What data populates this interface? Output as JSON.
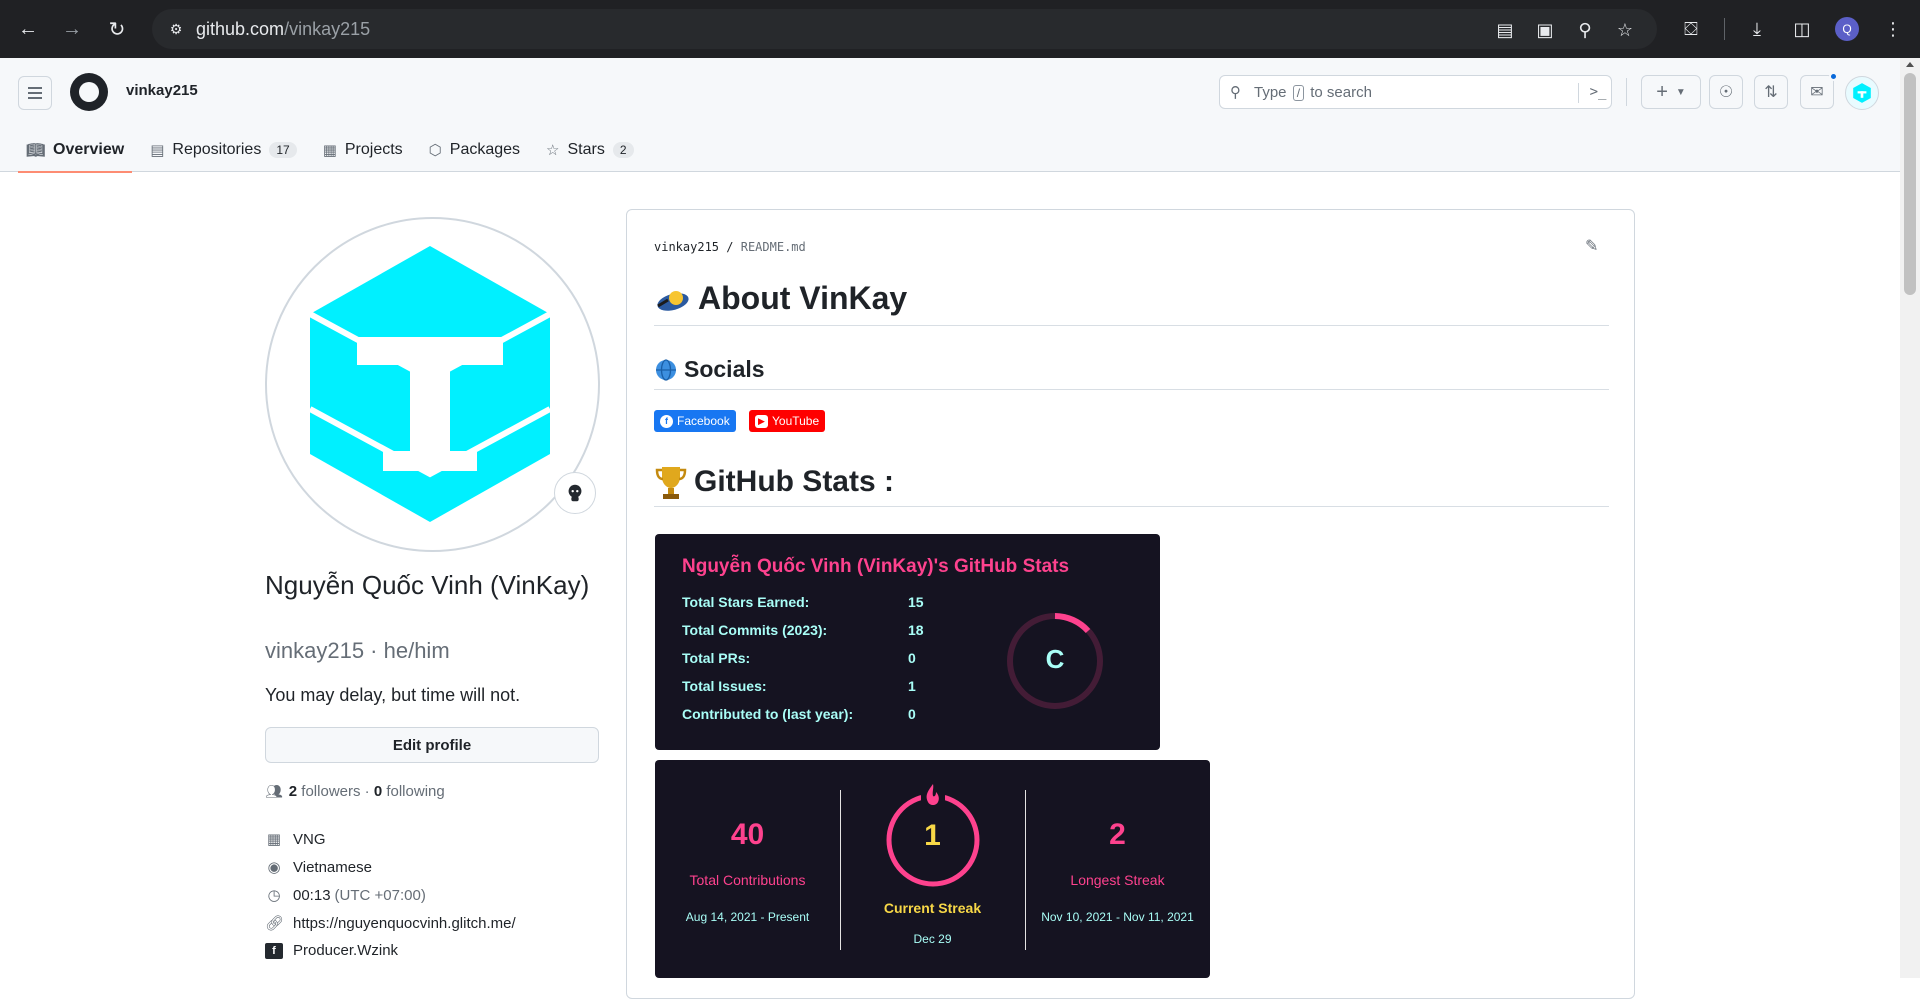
{
  "browser": {
    "url_host": "github.com",
    "url_path": "/vinkay215",
    "profile_initial": "Q"
  },
  "header": {
    "username": "vinkay215",
    "search": {
      "prefix": "Type",
      "key": "/",
      "suffix": "to search"
    },
    "command_glyph": ">_",
    "plus_label": "+"
  },
  "tabs": [
    {
      "label": "Overview",
      "icon": "book-icon",
      "count": null
    },
    {
      "label": "Repositories",
      "icon": "repo-icon",
      "count": "17"
    },
    {
      "label": "Projects",
      "icon": "table-icon",
      "count": null
    },
    {
      "label": "Packages",
      "icon": "package-icon",
      "count": null
    },
    {
      "label": "Stars",
      "icon": "star-icon",
      "count": "2"
    }
  ],
  "profile": {
    "full_name": "Nguyễn Quốc Vinh (VinKay)",
    "login": "vinkay215 · he/him",
    "bio": "You may delay, but time will not.",
    "edit_label": "Edit profile",
    "followers_count": "2",
    "followers_label": "followers",
    "following_count": "0",
    "following_label": "following",
    "company": "VNG",
    "location": "Vietnamese",
    "local_time": "00:13",
    "timezone": "(UTC +07:00)",
    "website": "https://nguyenquocvinh.glitch.me/",
    "facebook": "Producer.Wzink"
  },
  "readme": {
    "owner": "vinkay215",
    "file": "README.md",
    "h1": "About VinKay",
    "socials_heading": "Socials",
    "badges": [
      {
        "label": "Facebook",
        "color": "#1877f2"
      },
      {
        "label": "YouTube",
        "color": "#ff0000"
      }
    ],
    "stats_heading": "GitHub Stats :",
    "stats_card": {
      "title": "Nguyễn Quốc Vinh (VinKay)'s GitHub Stats",
      "rows": [
        {
          "label": "Total Stars Earned:",
          "value": "15"
        },
        {
          "label": "Total Commits (2023):",
          "value": "18"
        },
        {
          "label": "Total PRs:",
          "value": "0"
        },
        {
          "label": "Total Issues:",
          "value": "1"
        },
        {
          "label": "Contributed to (last year):",
          "value": "0"
        }
      ],
      "rank": "C"
    },
    "streak_card": {
      "total": {
        "value": "40",
        "label": "Total Contributions",
        "range": "Aug 14, 2021 - Present"
      },
      "current": {
        "value": "1",
        "label": "Current Streak",
        "range": "Dec 29"
      },
      "longest": {
        "value": "2",
        "label": "Longest Streak",
        "range": "Nov 10, 2021 - Nov 11, 2021"
      }
    }
  },
  "colors": {
    "accent_pink": "#fe428e",
    "accent_cyan": "#a9fef7",
    "accent_yellow": "#f8d847",
    "card_bg": "#151321",
    "tab_underline": "#fd8c73"
  }
}
